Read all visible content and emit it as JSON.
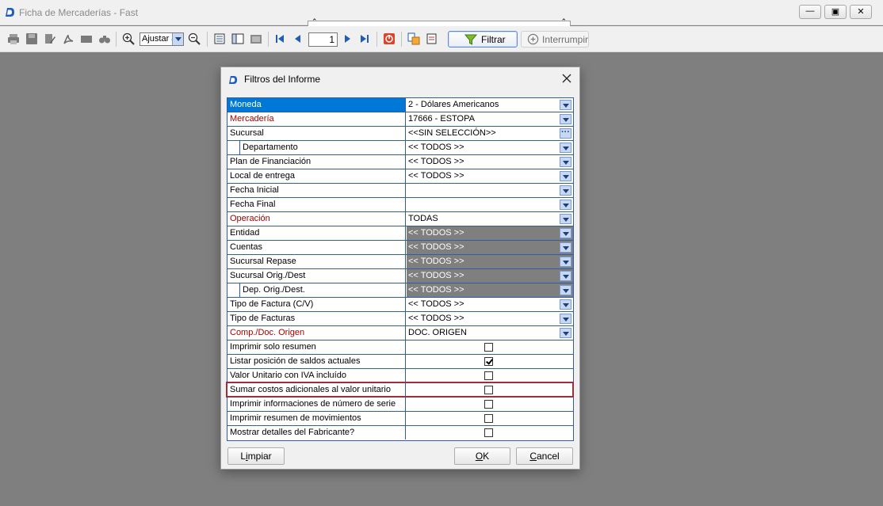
{
  "window": {
    "title": "Ficha de Mercaderías - Fast",
    "minimize_glyph": "—",
    "maximize_glyph": "▣",
    "close_glyph": "✕"
  },
  "toolbar": {
    "zoom_value": "Ajustar a",
    "page_number": "1",
    "filter_label": "Filtrar",
    "interrupt_label": "Interrumpir",
    "icons": [
      "print-icon",
      "save-icon",
      "edit-icon",
      "pdf-icon",
      "email-icon",
      "find-icon",
      "zoom-in-icon",
      "zoom-out-icon",
      "page-setup-icon",
      "outline-icon",
      "thumbnails-icon",
      "first-page-icon",
      "prev-page-icon",
      "next-page-icon",
      "last-page-icon",
      "stop-icon",
      "export-icon",
      "design-icon",
      "filter-icon",
      "interrupt-icon"
    ]
  },
  "dialog": {
    "title": "Filtros del Informe",
    "rows": [
      {
        "label": "Moneda",
        "value": "2 - Dólares Americanos",
        "kind": "dropdown",
        "required": false,
        "selected": true
      },
      {
        "label": "Mercadería",
        "value": "17666 - ESTOPA",
        "kind": "dropdown",
        "required": true
      },
      {
        "label": "Sucursal",
        "value": "<<SIN SELECCIÓN>>",
        "kind": "ellipsis"
      },
      {
        "label": "Departamento",
        "value": "<< TODOS >>",
        "kind": "dropdown",
        "indent": true
      },
      {
        "label": "Plan de Financiación",
        "value": "<< TODOS >>",
        "kind": "dropdown"
      },
      {
        "label": "Local de entrega",
        "value": "<< TODOS >>",
        "kind": "dropdown"
      },
      {
        "label": "Fecha Inicial",
        "value": "",
        "kind": "dropdown"
      },
      {
        "label": "Fecha Final",
        "value": "",
        "kind": "dropdown"
      },
      {
        "label": "Operación",
        "value": "TODAS",
        "kind": "dropdown",
        "required": true
      },
      {
        "label": "Entidad",
        "value": "<< TODOS >>",
        "kind": "dropdown",
        "disabled": true
      },
      {
        "label": "Cuentas",
        "value": "<< TODOS >>",
        "kind": "dropdown",
        "disabled": true
      },
      {
        "label": "Sucursal Repase",
        "value": "<< TODOS >>",
        "kind": "dropdown",
        "disabled": true
      },
      {
        "label": "Sucursal Orig./Dest",
        "value": "<< TODOS >>",
        "kind": "dropdown",
        "disabled": true
      },
      {
        "label": "Dep. Orig./Dest.",
        "value": "<< TODOS >>",
        "kind": "dropdown",
        "disabled": true,
        "indent": true
      },
      {
        "label": "Tipo de Factura (C/V)",
        "value": "<< TODOS >>",
        "kind": "dropdown"
      },
      {
        "label": "Tipo de Facturas",
        "value": "<< TODOS >>",
        "kind": "dropdown"
      },
      {
        "label": "Comp./Doc. Origen",
        "value": "DOC. ORIGEN",
        "kind": "dropdown",
        "required": true
      },
      {
        "label": "Imprimir solo resumen",
        "kind": "checkbox",
        "checked": false
      },
      {
        "label": "Listar posición de saldos actuales",
        "kind": "checkbox",
        "checked": true
      },
      {
        "label": "Valor Unitario con IVA incluído",
        "kind": "checkbox",
        "checked": false
      },
      {
        "label": "Sumar costos adicionales al valor unitario",
        "kind": "checkbox",
        "checked": false,
        "highlighted": true
      },
      {
        "label": "Imprimir informaciones de número de serie",
        "kind": "checkbox",
        "checked": false
      },
      {
        "label": "Imprimir resumen de movimientos",
        "kind": "checkbox",
        "checked": false
      },
      {
        "label": "Mostrar detalles del Fabricante?",
        "kind": "checkbox",
        "checked": false
      }
    ],
    "buttons": {
      "clear_prefix": "L",
      "clear_hot": "i",
      "clear_rest": "mpiar",
      "ok_hot": "O",
      "ok_rest": "K",
      "cancel_hot": "C",
      "cancel_rest": "ancel"
    }
  },
  "colors": {
    "grid_border": "#2f5ea6",
    "selected_row": "#0078d7",
    "required_label": "#a80000",
    "disabled_cell": "#7f7f7f",
    "highlight_box": "#9b2f3a"
  }
}
